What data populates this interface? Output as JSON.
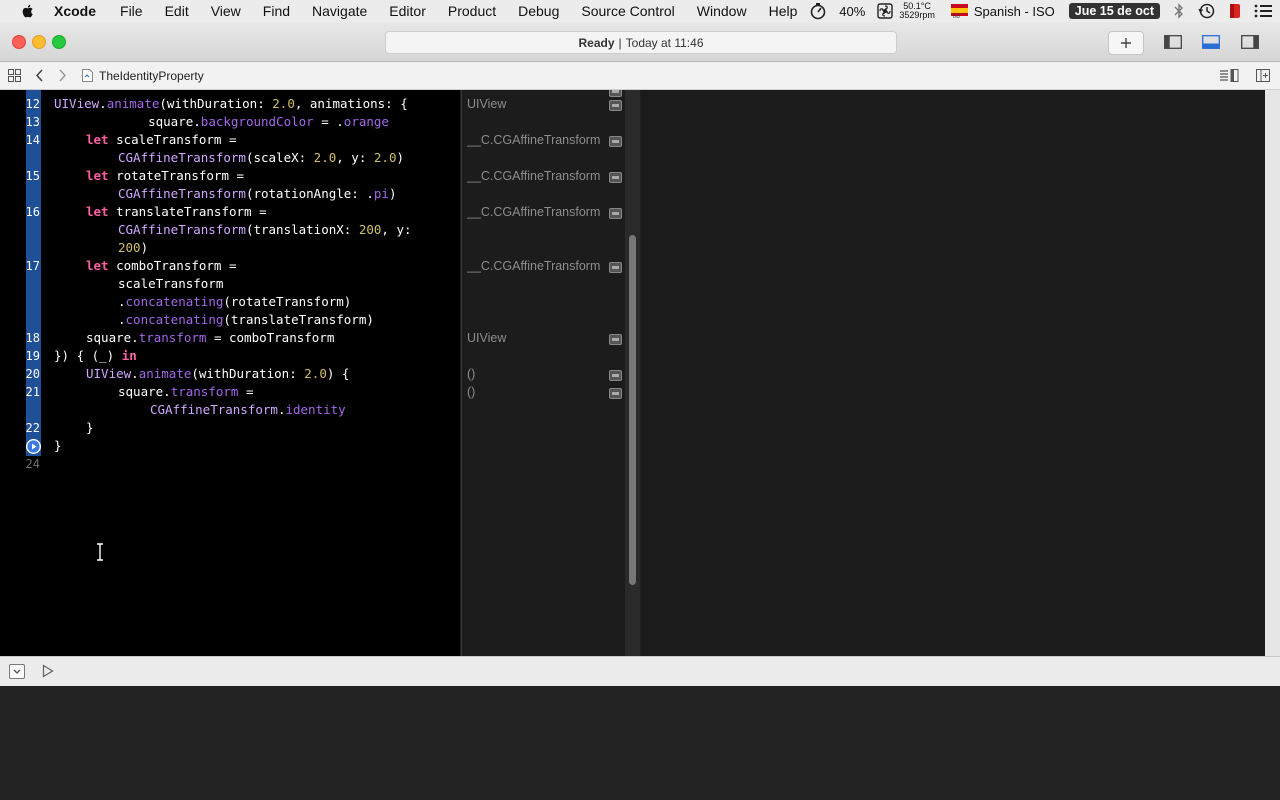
{
  "menubar": {
    "items": [
      "Xcode",
      "File",
      "Edit",
      "View",
      "Find",
      "Navigate",
      "Editor",
      "Product",
      "Debug",
      "Source Control",
      "Window",
      "Help"
    ],
    "battery": "40%",
    "temp_line1": "50.1°C",
    "temp_line2": "3529rpm",
    "input_source": "Spanish - ISO",
    "date": "Jue 15 de oct"
  },
  "titlebar": {
    "status_bold": "Ready",
    "status_separator": "|",
    "status_time": "Today at 11:46"
  },
  "jumpbar": {
    "file": "TheIdentityProperty"
  },
  "editor": {
    "lines": [
      {
        "n": "12",
        "c": [
          [
            "t",
            "UIView"
          ],
          [
            "p",
            "."
          ],
          [
            "pr",
            "animate"
          ],
          [
            "p",
            "(withDuration: "
          ],
          [
            "n",
            "2.0"
          ],
          [
            "p",
            ", animations: {"
          ]
        ]
      },
      {
        "n": "13",
        "c": [
          [
            "p",
            "    square."
          ],
          [
            "pr",
            "backgroundColor"
          ],
          [
            "p",
            " = ."
          ],
          [
            "pr",
            "orange"
          ]
        ]
      },
      {
        "n": "14",
        "c": [
          [
            "k",
            "let"
          ],
          [
            "p",
            " scaleTransform ="
          ]
        ]
      },
      {
        "n": "",
        "c": [
          [
            "t",
            "CGAffineTransform"
          ],
          [
            "p",
            "(scaleX: "
          ],
          [
            "n",
            "2.0"
          ],
          [
            "p",
            ", y: "
          ],
          [
            "n",
            "2.0"
          ],
          [
            "p",
            ")"
          ]
        ]
      },
      {
        "n": "15",
        "c": [
          [
            "k",
            "let"
          ],
          [
            "p",
            " rotateTransform ="
          ]
        ]
      },
      {
        "n": "",
        "c": [
          [
            "t",
            "CGAffineTransform"
          ],
          [
            "p",
            "(rotationAngle: ."
          ],
          [
            "pr",
            "pi"
          ],
          [
            "p",
            ")"
          ]
        ]
      },
      {
        "n": "16",
        "c": [
          [
            "k",
            "let"
          ],
          [
            "p",
            " translateTransform ="
          ]
        ]
      },
      {
        "n": "",
        "c": [
          [
            "t",
            "CGAffineTransform"
          ],
          [
            "p",
            "(translationX: "
          ],
          [
            "n",
            "200"
          ],
          [
            "p",
            ", y:"
          ]
        ]
      },
      {
        "n": "",
        "c": [
          [
            "n",
            "200"
          ],
          [
            "p",
            ")"
          ]
        ]
      },
      {
        "n": "17",
        "c": [
          [
            "k",
            "let"
          ],
          [
            "p",
            " comboTransform ="
          ]
        ]
      },
      {
        "n": "",
        "c": [
          [
            "p",
            "scaleTransform"
          ]
        ]
      },
      {
        "n": "",
        "c": [
          [
            "p",
            "."
          ],
          [
            "pr",
            "concatenating"
          ],
          [
            "p",
            "(rotateTransform)"
          ]
        ]
      },
      {
        "n": "",
        "c": [
          [
            "p",
            "."
          ],
          [
            "pr",
            "concatenating"
          ],
          [
            "p",
            "(translateTransform)"
          ]
        ]
      },
      {
        "n": "18",
        "c": [
          [
            "p",
            "square."
          ],
          [
            "pr",
            "transform"
          ],
          [
            "p",
            " = comboTransform"
          ]
        ]
      },
      {
        "n": "19",
        "c": [
          [
            "p",
            "}) { (_) "
          ],
          [
            "k",
            "in"
          ]
        ]
      },
      {
        "n": "20",
        "c": [
          [
            "t",
            "UIView"
          ],
          [
            "p",
            "."
          ],
          [
            "pr",
            "animate"
          ],
          [
            "p",
            "(withDuration: "
          ],
          [
            "n",
            "2.0"
          ],
          [
            "p",
            ") {"
          ]
        ]
      },
      {
        "n": "21",
        "c": [
          [
            "p",
            "square."
          ],
          [
            "pr",
            "transform"
          ],
          [
            "p",
            " ="
          ]
        ]
      },
      {
        "n": "",
        "c": [
          [
            "t",
            "CGAffineTransform"
          ],
          [
            "p",
            "."
          ],
          [
            "pr",
            "identity"
          ]
        ]
      },
      {
        "n": "22",
        "c": [
          [
            "p",
            "}"
          ]
        ]
      },
      {
        "n": "",
        "c": [
          [
            "p",
            "}"
          ]
        ]
      },
      {
        "n": "24",
        "c": []
      }
    ]
  },
  "results": [
    {
      "text": "UIView"
    },
    {
      "text": "__C.CGAffineTransform"
    },
    {
      "text": "__C.CGAffineTransform"
    },
    {
      "text": "__C.CGAffineTransform"
    },
    {
      "text": "__C.CGAffineTransform"
    },
    {
      "text": "UIView"
    },
    {
      "text": "()"
    },
    {
      "text": "()"
    }
  ],
  "icons": {
    "apple": "apple-icon",
    "add": "plus-icon",
    "related": "grid-icon",
    "back": "chevron-left-icon",
    "forward": "chevron-right-icon"
  }
}
